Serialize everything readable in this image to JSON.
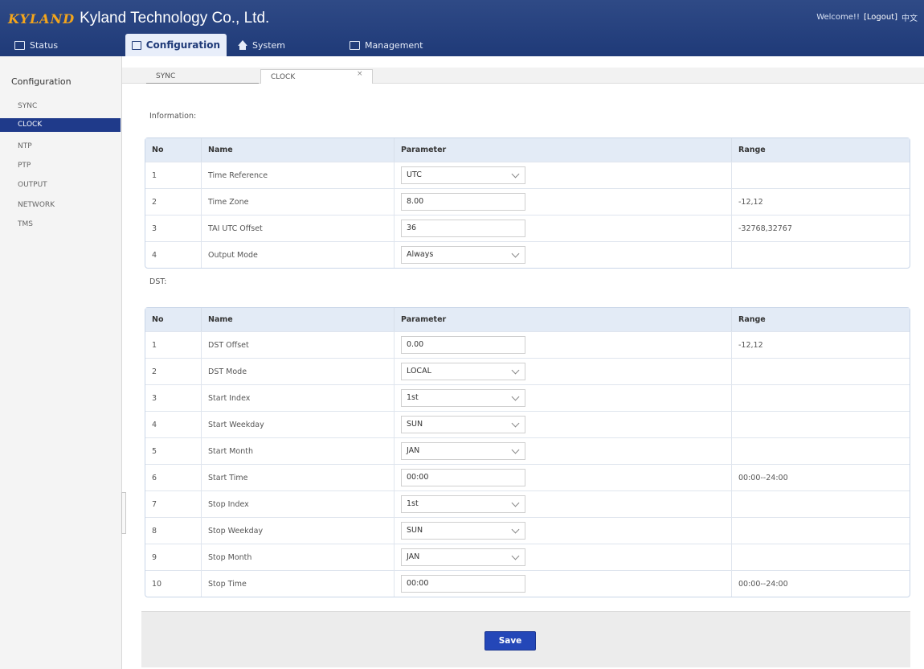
{
  "header": {
    "logo": "KYLAND",
    "company": "Kyland Technology Co., Ltd.",
    "welcome": "Welcome!!",
    "logout": "[Logout]",
    "extra": "中文"
  },
  "nav": {
    "status": "Status",
    "configuration": "Configuration",
    "system": "System",
    "management": "Management"
  },
  "sidebar": {
    "title": "Configuration",
    "items": [
      "SYNC",
      "CLOCK",
      "NTP",
      "PTP",
      "OUTPUT",
      "NETWORK",
      "TMS"
    ],
    "active": "CLOCK"
  },
  "tabs": {
    "sync": "SYNC",
    "clock": "CLOCK",
    "close": "×"
  },
  "information": {
    "label": "Information:",
    "headers": [
      "No",
      "Name",
      "Parameter",
      "Range"
    ],
    "rows": [
      {
        "no": "1",
        "name": "Time Reference",
        "value": "UTC",
        "kind": "select",
        "range": ""
      },
      {
        "no": "2",
        "name": "Time Zone",
        "value": "8.00",
        "kind": "input",
        "range": "-12,12"
      },
      {
        "no": "3",
        "name": "TAI UTC Offset",
        "value": "36",
        "kind": "input",
        "range": "-32768,32767"
      },
      {
        "no": "4",
        "name": "Output Mode",
        "value": "Always",
        "kind": "select",
        "range": ""
      }
    ]
  },
  "dst": {
    "label": "DST:",
    "headers": [
      "No",
      "Name",
      "Parameter",
      "Range"
    ],
    "rows": [
      {
        "no": "1",
        "name": "DST Offset",
        "value": "0.00",
        "kind": "input",
        "range": "-12,12"
      },
      {
        "no": "2",
        "name": "DST Mode",
        "value": "LOCAL",
        "kind": "select",
        "range": ""
      },
      {
        "no": "3",
        "name": "Start Index",
        "value": "1st",
        "kind": "select",
        "range": ""
      },
      {
        "no": "4",
        "name": "Start Weekday",
        "value": "SUN",
        "kind": "select",
        "range": ""
      },
      {
        "no": "5",
        "name": "Start Month",
        "value": "JAN",
        "kind": "select",
        "range": ""
      },
      {
        "no": "6",
        "name": "Start Time",
        "value": "00:00",
        "kind": "input",
        "range": "00:00--24:00"
      },
      {
        "no": "7",
        "name": "Stop Index",
        "value": "1st",
        "kind": "select",
        "range": ""
      },
      {
        "no": "8",
        "name": "Stop Weekday",
        "value": "SUN",
        "kind": "select",
        "range": ""
      },
      {
        "no": "9",
        "name": "Stop Month",
        "value": "JAN",
        "kind": "select",
        "range": ""
      },
      {
        "no": "10",
        "name": "Stop Time",
        "value": "00:00",
        "kind": "input",
        "range": "00:00--24:00"
      }
    ]
  },
  "footer": {
    "save_label": "Save"
  },
  "colors": {
    "header_bg": "#1f3a78",
    "logo": "#f3a51c",
    "sidebar_active": "#1f3a8a",
    "save_button": "#2447b8",
    "table_header": "#e3ebf6"
  }
}
